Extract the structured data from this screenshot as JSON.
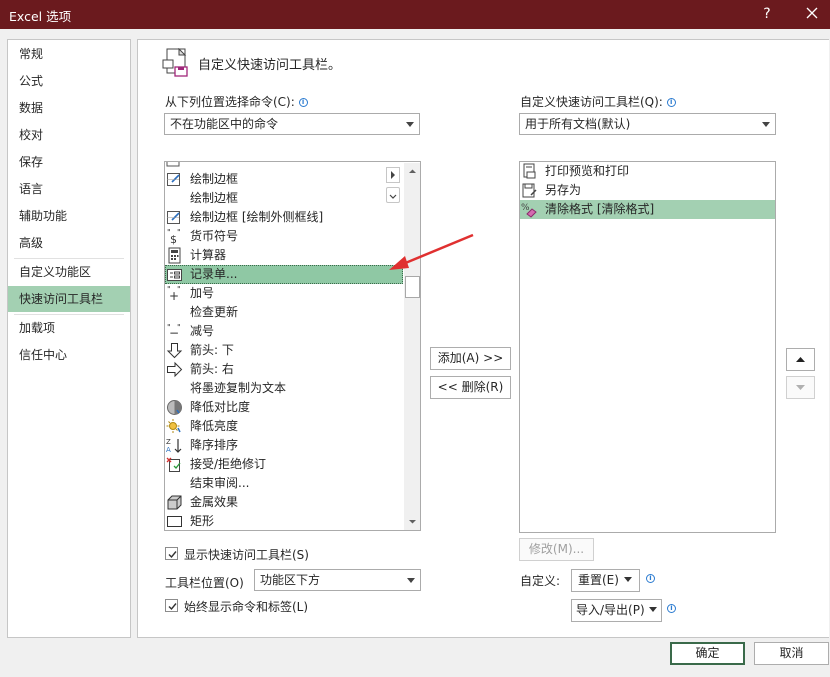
{
  "window": {
    "title": "Excel 选项",
    "help": "?"
  },
  "nav": {
    "items": [
      {
        "label": "常规"
      },
      {
        "label": "公式"
      },
      {
        "label": "数据"
      },
      {
        "label": "校对"
      },
      {
        "label": "保存"
      },
      {
        "label": "语言"
      },
      {
        "label": "辅助功能"
      },
      {
        "label": "高级"
      },
      {
        "label": "自定义功能区"
      },
      {
        "label": "快速访问工具栏"
      },
      {
        "label": "加载项"
      },
      {
        "label": "信任中心"
      }
    ],
    "active": "快速访问工具栏"
  },
  "header": {
    "title": "自定义快速访问工具栏。"
  },
  "left": {
    "choose_label": "从下列位置选择命令(C):",
    "choose_value": "不在功能区中的命令",
    "commands": [
      {
        "label": "绘制边框",
        "icon": "draw-border-icon"
      },
      {
        "label": "绘制边框",
        "icon": "none"
      },
      {
        "label": "绘制边框 [绘制外侧框线]",
        "icon": "draw-border-icon"
      },
      {
        "label": "货币符号",
        "icon": "currency-icon"
      },
      {
        "label": "计算器",
        "icon": "calculator-icon"
      },
      {
        "label": "记录单...",
        "icon": "form-icon"
      },
      {
        "label": "加号",
        "icon": "plus-quote-icon"
      },
      {
        "label": "检查更新",
        "icon": "none"
      },
      {
        "label": "减号",
        "icon": "minus-quote-icon"
      },
      {
        "label": "箭头: 下",
        "icon": "arrow-down-icon"
      },
      {
        "label": "箭头: 右",
        "icon": "arrow-right-icon"
      },
      {
        "label": "将墨迹复制为文本",
        "icon": "none"
      },
      {
        "label": "降低对比度",
        "icon": "contrast-icon"
      },
      {
        "label": "降低亮度",
        "icon": "brightness-icon"
      },
      {
        "label": "降序排序",
        "icon": "sort-desc-icon"
      },
      {
        "label": "接受/拒绝修订",
        "icon": "accept-reject-icon"
      },
      {
        "label": "结束审阅...",
        "icon": "none"
      },
      {
        "label": "金属效果",
        "icon": "metal-icon"
      },
      {
        "label": "矩形",
        "icon": "rectangle-icon"
      }
    ],
    "selected_index": 5,
    "show_toolbar_label": "显示快速访问工具栏(S)",
    "show_toolbar_checked": true,
    "position_label": "工具栏位置(O)",
    "position_value": "功能区下方",
    "always_show_label": "始终显示命令和标签(L)",
    "always_show_checked": true
  },
  "middle": {
    "add_label": "添加(A) >>",
    "remove_label": "<< 删除(R)"
  },
  "right": {
    "customize_label": "自定义快速访问工具栏(Q):",
    "customize_value": "用于所有文档(默认)",
    "items": [
      {
        "label": "打印预览和打印",
        "icon": "print-preview-icon"
      },
      {
        "label": "另存为",
        "icon": "save-as-icon"
      },
      {
        "label": "清除格式 [清除格式]",
        "icon": "clear-format-icon"
      }
    ],
    "selected_index": 2,
    "modify_label": "修改(M)...",
    "customize_text": "自定义:",
    "reset_label": "重置(E)",
    "import_export_label": "导入/导出(P)"
  },
  "footer": {
    "ok_label": "确定",
    "cancel_label": "取消"
  },
  "colors": {
    "titlebar": "#6b1a1e",
    "accent": "#a3d0b2",
    "arrow": "#e03030"
  }
}
